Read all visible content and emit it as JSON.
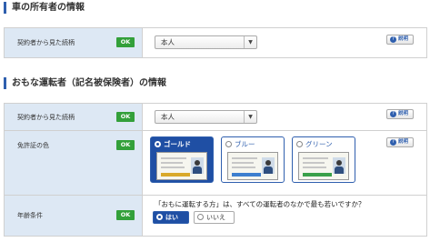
{
  "owner_section": {
    "title": "車の所有者の情報",
    "rows": [
      {
        "label": "契約者から見た続柄",
        "status": "OK",
        "select_value": "本人",
        "help_label": "説明"
      }
    ]
  },
  "driver_section": {
    "title": "おもな運転者（記名被保険者）の情報",
    "relation": {
      "label": "契約者から見た続柄",
      "status": "OK",
      "select_value": "本人",
      "help_label": "説明"
    },
    "license_color": {
      "label": "免許証の色",
      "status": "OK",
      "help_label": "説明",
      "options": [
        {
          "label": "ゴールド",
          "selected": true,
          "band_color": "#d9a92a"
        },
        {
          "label": "ブルー",
          "selected": false,
          "band_color": "#3d7fcf"
        },
        {
          "label": "グリーン",
          "selected": false,
          "band_color": "#3aa04a"
        }
      ]
    },
    "age_condition": {
      "label": "年齢条件",
      "status": "OK",
      "question": "「おもに運転する方」は、すべての運転者のなかで最も若いですか？",
      "options": [
        {
          "label": "はい",
          "selected": true
        },
        {
          "label": "いいえ",
          "selected": false
        }
      ]
    }
  },
  "colors": {
    "accent": "#2f5fae",
    "ok": "#33a03a",
    "label_bg": "#dde8f4",
    "selected_bg": "#1f4fa4"
  }
}
